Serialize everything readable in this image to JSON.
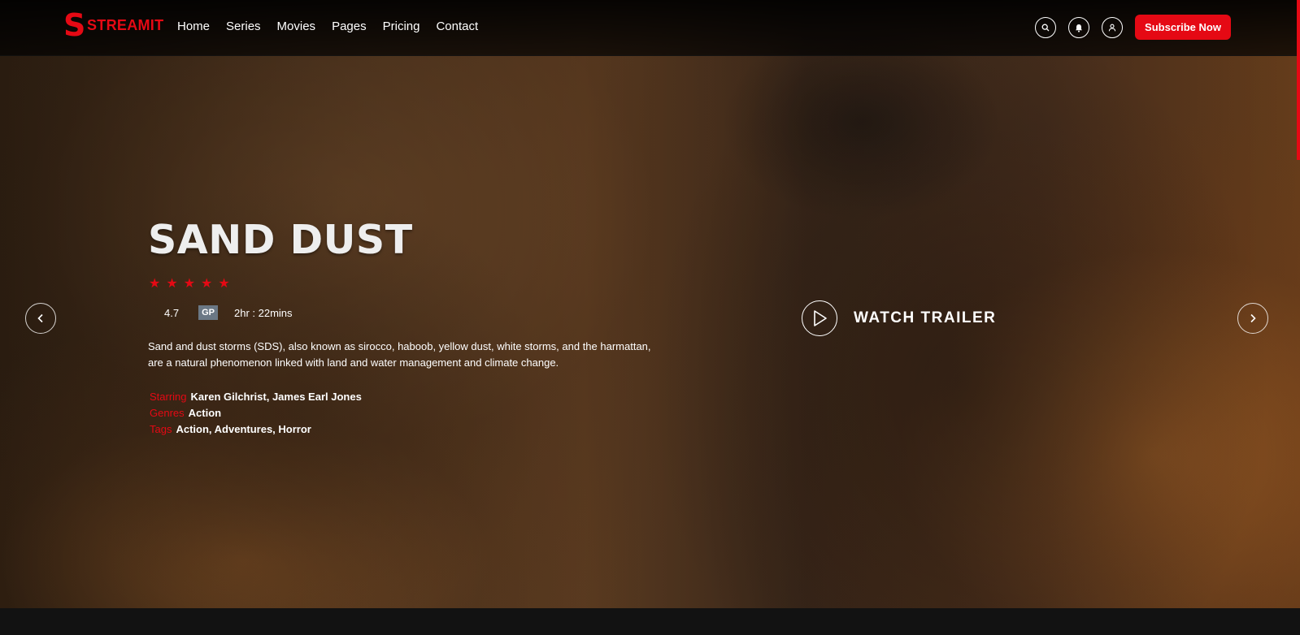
{
  "brand": {
    "name": "STREAMIT",
    "mark": "S",
    "accent": "#e50914"
  },
  "nav": {
    "items": [
      {
        "label": "Home"
      },
      {
        "label": "Series"
      },
      {
        "label": "Movies"
      },
      {
        "label": "Pages"
      },
      {
        "label": "Pricing"
      },
      {
        "label": "Contact"
      }
    ]
  },
  "header_icons": [
    "search-icon",
    "bell-icon",
    "user-icon"
  ],
  "subscribe_label": "Subscribe Now",
  "hero": {
    "title": "SAND DUST",
    "stars": 5,
    "rating": "4.7",
    "badge": "GP",
    "duration": "2hr : 22mins",
    "description": "Sand and dust storms (SDS), also known as sirocco, haboob, yellow dust, white storms, and the harmattan, are a natural phenomenon linked with land and water management and climate change.",
    "starring_label": "Starring",
    "starring": "Karen Gilchrist, James Earl Jones",
    "genres_label": "Genres",
    "genres": "Action",
    "tags_label": "Tags",
    "tags": "Action, Adventures, Horror",
    "trailer_label": "WATCH TRAILER"
  }
}
